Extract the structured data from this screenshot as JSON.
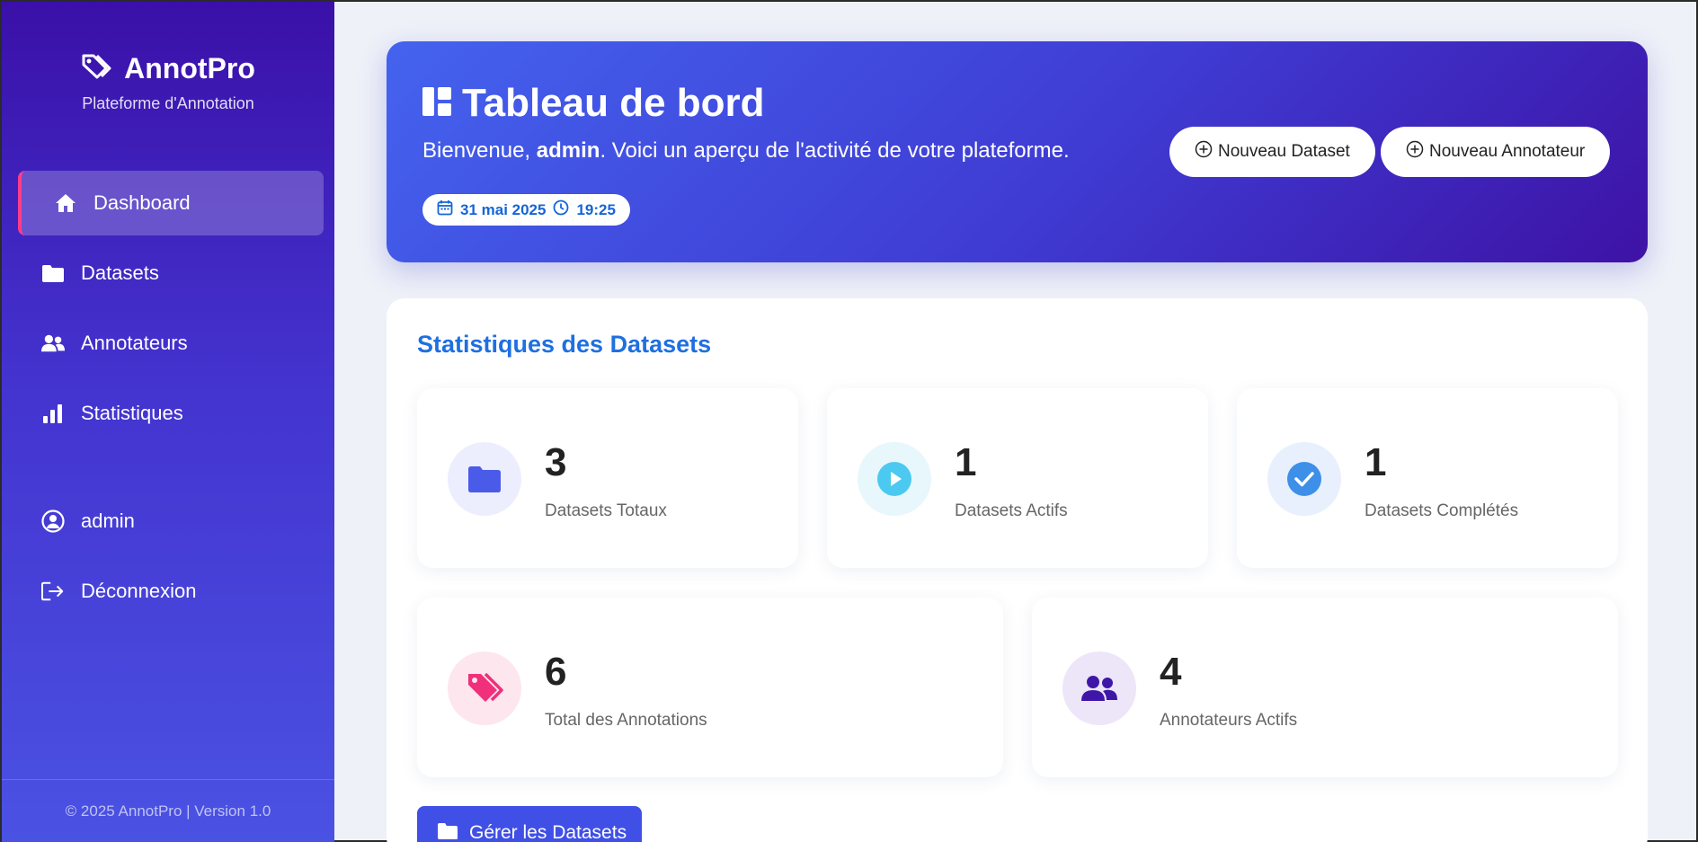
{
  "sidebar": {
    "brand_title": "AnnotPro",
    "brand_subtitle": "Plateforme d'Annotation",
    "items": [
      {
        "label": "Dashboard",
        "icon": "home-icon"
      },
      {
        "label": "Datasets",
        "icon": "folder-icon"
      },
      {
        "label": "Annotateurs",
        "icon": "users-icon"
      },
      {
        "label": "Statistiques",
        "icon": "bar-chart-icon"
      }
    ],
    "user_label": "admin",
    "logout_label": "Déconnexion",
    "footer": "© 2025 AnnotPro | Version 1.0"
  },
  "hero": {
    "title": "Tableau de bord",
    "welcome_prefix": "Bienvenue, ",
    "username": "admin",
    "welcome_suffix": ". Voici un aperçu de l'activité de votre plateforme.",
    "date": "31 mai 2025",
    "time": "19:25",
    "new_dataset": "Nouveau Dataset",
    "new_annotator": "Nouveau Annotateur"
  },
  "stats": {
    "title": "Statistiques des Datasets",
    "total_datasets": {
      "value": "3",
      "label": "Datasets Totaux"
    },
    "active_datasets": {
      "value": "1",
      "label": "Datasets Actifs"
    },
    "completed_datasets": {
      "value": "1",
      "label": "Datasets Complétés"
    },
    "total_annotations": {
      "value": "6",
      "label": "Total des Annotations"
    },
    "active_annotators": {
      "value": "4",
      "label": "Annotateurs Actifs"
    },
    "manage_button": "Gérer les Datasets"
  },
  "colors": {
    "accent": "#1f6fe0",
    "active_border": "#ff3d8b",
    "button": "#4050e6"
  }
}
